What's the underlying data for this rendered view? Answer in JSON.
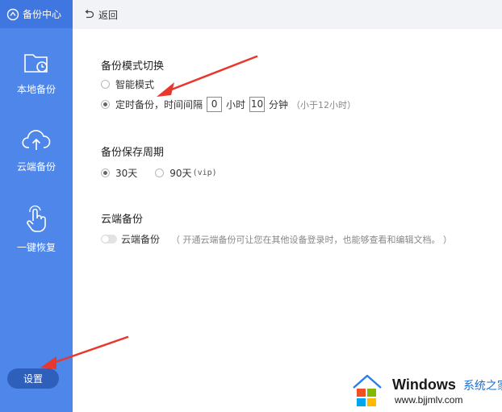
{
  "sidebar": {
    "brand_label": "备份中心",
    "items": [
      {
        "label": "本地备份",
        "icon": "folder-clock-icon"
      },
      {
        "label": "云端备份",
        "icon": "cloud-upload-icon"
      },
      {
        "label": "一键恢复",
        "icon": "hand-pointer-icon"
      }
    ],
    "settings_label": "设置"
  },
  "topbar": {
    "back_label": "返回",
    "icon": "undo-arrow-icon"
  },
  "backup_mode": {
    "title": "备份模式切换",
    "smart_label": "智能模式",
    "scheduled_label": "定时备份，时间间隔",
    "hours_value": "0",
    "hours_unit": "小时",
    "minutes_value": "10",
    "minutes_unit": "分钟",
    "hint": "（小于12小时）",
    "selected": "scheduled"
  },
  "retention": {
    "title": "备份保存周期",
    "option_30": "30天",
    "option_90": "90天",
    "option_90_tag": "(vip)",
    "selected": "30"
  },
  "cloud_backup": {
    "title": "云端备份",
    "toggle_label": "云端备份",
    "toggle_on": false,
    "hint": "（ 开通云端备份可让您在其他设备登录时，也能够查看和编辑文档。 ）"
  },
  "watermark": {
    "brand": "Windows",
    "site_name": "系统之家",
    "url": "www.bjjmlv.com"
  },
  "colors": {
    "sidebar": "#4f86e9",
    "sidebar_header": "#3f76df",
    "settings_button": "#2e5fba",
    "arrow": "#e8372c"
  }
}
